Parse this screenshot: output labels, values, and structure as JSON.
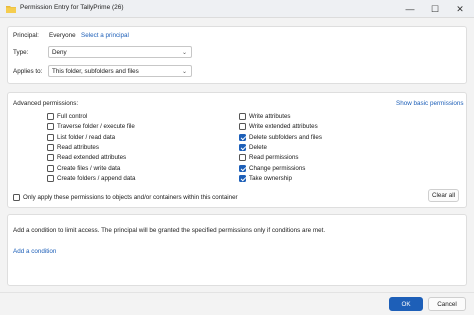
{
  "window": {
    "title": "Permission Entry for TallyPrime (26)",
    "minimize": "—",
    "maximize": "☐",
    "close": "✕"
  },
  "principal": {
    "label": "Principal:",
    "value": "Everyone",
    "select_link": "Select a principal"
  },
  "type": {
    "label": "Type:",
    "value": "Deny"
  },
  "applies_to": {
    "label": "Applies to:",
    "value": "This folder, subfolders and files"
  },
  "advanced": {
    "heading": "Advanced permissions:",
    "show_basic_link": "Show basic permissions",
    "left": [
      {
        "label": "Full control",
        "checked": false
      },
      {
        "label": "Traverse folder / execute file",
        "checked": false
      },
      {
        "label": "List folder / read data",
        "checked": false
      },
      {
        "label": "Read attributes",
        "checked": false
      },
      {
        "label": "Read extended attributes",
        "checked": false
      },
      {
        "label": "Create files / write data",
        "checked": false
      },
      {
        "label": "Create folders / append data",
        "checked": false
      }
    ],
    "right": [
      {
        "label": "Write attributes",
        "checked": false
      },
      {
        "label": "Write extended attributes",
        "checked": false
      },
      {
        "label": "Delete subfolders and files",
        "checked": true
      },
      {
        "label": "Delete",
        "checked": true
      },
      {
        "label": "Read permissions",
        "checked": false
      },
      {
        "label": "Change permissions",
        "checked": true
      },
      {
        "label": "Take ownership",
        "checked": true
      }
    ],
    "only_apply_label": "Only apply these permissions to objects and/or containers within this container",
    "clear_all": "Clear all"
  },
  "conditions": {
    "description": "Add a condition to limit access. The principal will be granted the specified permissions only if conditions are met.",
    "add_link": "Add a condition"
  },
  "footer": {
    "ok": "OK",
    "cancel": "Cancel"
  },
  "colors": {
    "accent": "#1d5fb8",
    "background": "#f3f3f3"
  }
}
